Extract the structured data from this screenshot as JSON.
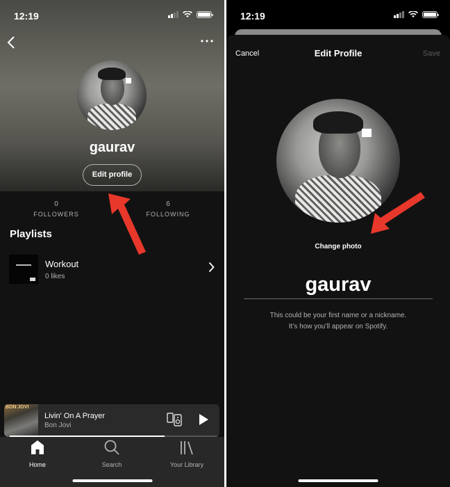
{
  "left_screen": {
    "status": {
      "time": "12:19"
    },
    "profile": {
      "name": "gaurav",
      "edit_button": "Edit profile",
      "followers": {
        "count": "0",
        "label": "FOLLOWERS"
      },
      "following": {
        "count": "6",
        "label": "FOLLOWING"
      }
    },
    "playlists": {
      "title": "Playlists",
      "items": [
        {
          "name": "Workout",
          "subtitle": "0 likes"
        }
      ]
    },
    "now_playing": {
      "art_text": "BON JOVI",
      "title": "Livin' On A Prayer",
      "artist": "Bon Jovi",
      "progress": 0.74
    },
    "tabs": [
      {
        "label": "Home",
        "icon": "home-icon",
        "active": true
      },
      {
        "label": "Search",
        "icon": "search-icon",
        "active": false
      },
      {
        "label": "Your Library",
        "icon": "library-icon",
        "active": false
      }
    ]
  },
  "right_screen": {
    "status": {
      "time": "12:19"
    },
    "header": {
      "cancel": "Cancel",
      "title": "Edit Profile",
      "save": "Save"
    },
    "change_photo": "Change photo",
    "name_value": "gaurav",
    "hint_line1": "This could be your first name or a nickname.",
    "hint_line2": "It’s how you’ll appear on Spotify."
  },
  "colors": {
    "background": "#121212",
    "tabbar": "#282828",
    "secondary_text": "#b3b3b3",
    "annotation_arrow": "#e8382b"
  }
}
